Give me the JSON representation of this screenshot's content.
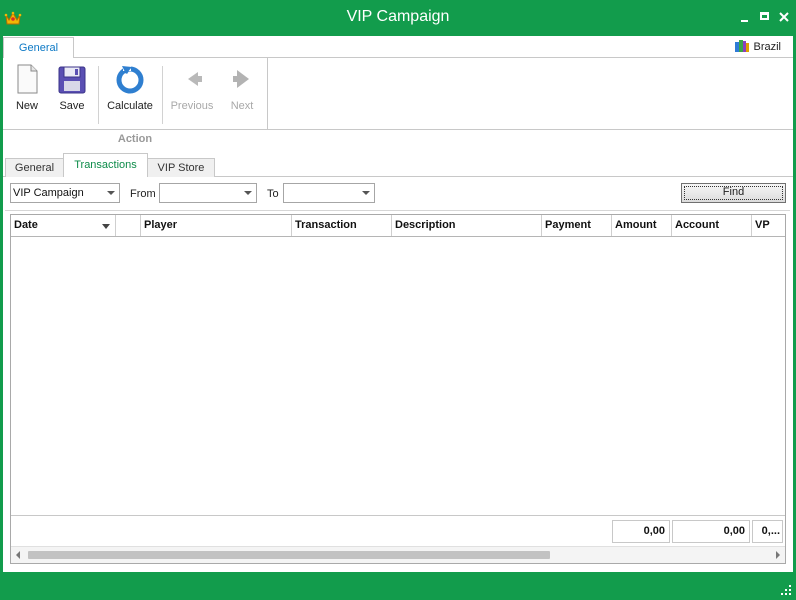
{
  "window": {
    "title": "VIP Campaign"
  },
  "ribbon": {
    "tab": "General",
    "region": "Brazil",
    "buttons": {
      "new": "New",
      "save": "Save",
      "calculate": "Calculate",
      "previous": "Previous",
      "next": "Next"
    },
    "group_label": "Action"
  },
  "tabs": [
    "General",
    "Transactions",
    "VIP Store"
  ],
  "active_tab": "Transactions",
  "filters": {
    "campaign": "VIP Campaign",
    "from_label": "From",
    "from_value": "",
    "to_label": "To",
    "to_value": "",
    "find_label": "Find"
  },
  "grid": {
    "columns": [
      "Date",
      "",
      "Player",
      "Transaction",
      "Description",
      "Payment",
      "Amount",
      "Account",
      "VP"
    ],
    "rows": [],
    "totals": {
      "amount": "0,00",
      "account": "0,00",
      "vp": "0,..."
    }
  },
  "colors": {
    "accent": "#129c4c",
    "tab_text": "#0d79c5"
  }
}
